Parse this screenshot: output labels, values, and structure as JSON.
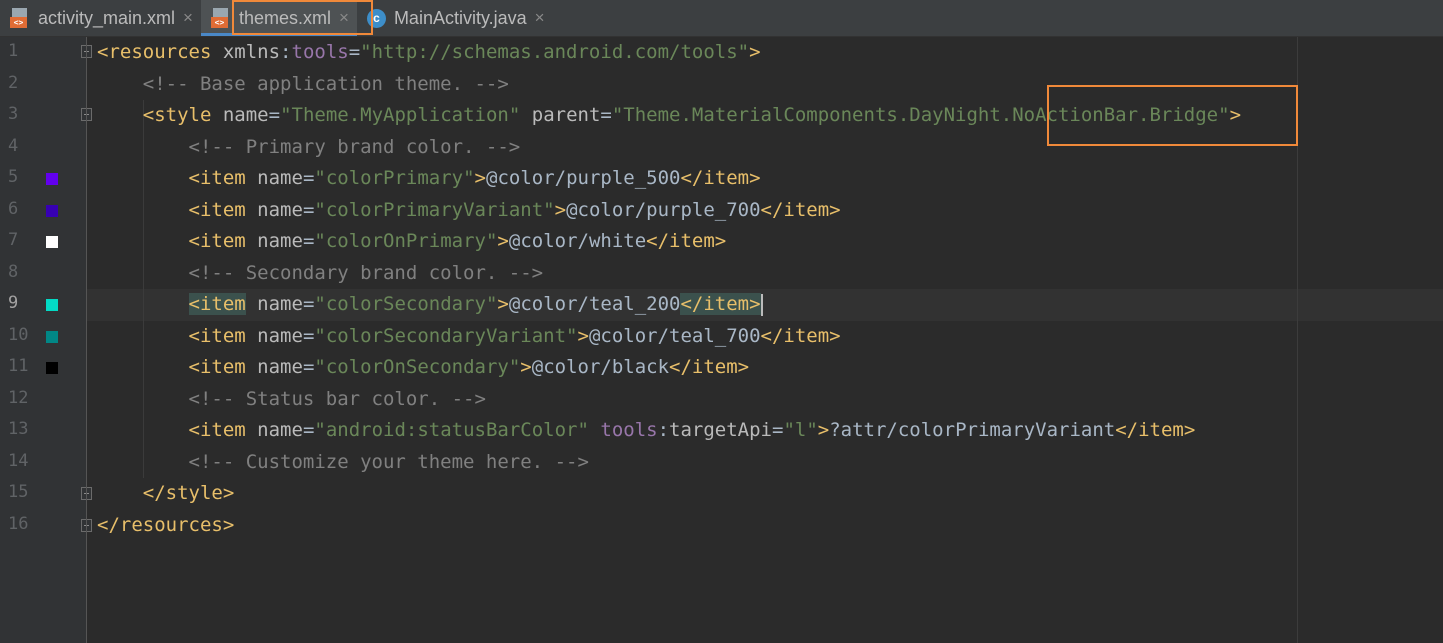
{
  "tabs": [
    {
      "label": "activity_main.xml",
      "icon": "xml-file-icon",
      "active": false
    },
    {
      "label": "themes.xml",
      "icon": "xml-file-icon",
      "active": true
    },
    {
      "label": "MainActivity.java",
      "icon": "java-class-icon",
      "active": false
    }
  ],
  "icons": {
    "xml_badge": "<>",
    "class_badge": "c",
    "close": "×"
  },
  "colors": {
    "purple_500": "#6200ee",
    "purple_700": "#3700b3",
    "white": "#ffffff",
    "teal_200": "#03dac5",
    "teal_700": "#018786",
    "black": "#000000",
    "highlight_border": "#f0893a"
  },
  "current_line": 9,
  "line_numbers": [
    "1",
    "2",
    "3",
    "4",
    "5",
    "6",
    "7",
    "8",
    "9",
    "10",
    "11",
    "12",
    "13",
    "14",
    "15",
    "16"
  ],
  "code": {
    "l1": {
      "open": "<resources",
      "attr": "xmlns",
      "colon": ":",
      "ns": "tools",
      "eq": "=",
      "val": "\"http://schemas.android.com/tools\"",
      "close": ">"
    },
    "l2": "<!-- Base application theme. -->",
    "l3": {
      "open": "<style",
      "attr1": "name",
      "eq1": "=",
      "val1": "\"Theme.MyApplication\"",
      "attr2": "parent",
      "eq2": "=",
      "val2a": "\"Theme.MaterialComponents.DayNight",
      "val2b": ".NoActionBar.Bridge\"",
      "close": ">"
    },
    "l4": "<!-- Primary brand color. -->",
    "l5": {
      "open": "<item",
      "attr": "name",
      "eq": "=",
      "val": "\"colorPrimary\"",
      "gt": ">",
      "text": "@color/purple_500",
      "close": "</item>"
    },
    "l6": {
      "open": "<item",
      "attr": "name",
      "eq": "=",
      "val": "\"colorPrimaryVariant\"",
      "gt": ">",
      "text": "@color/purple_700",
      "close": "</item>"
    },
    "l7": {
      "open": "<item",
      "attr": "name",
      "eq": "=",
      "val": "\"colorOnPrimary\"",
      "gt": ">",
      "text": "@color/white",
      "close": "</item>"
    },
    "l8": "<!-- Secondary brand color. -->",
    "l9": {
      "open": "<item",
      "attr": "name",
      "eq": "=",
      "val": "\"colorSecondary\"",
      "gt": ">",
      "text": "@color/teal_200",
      "close": "</item>"
    },
    "l10": {
      "open": "<item",
      "attr": "name",
      "eq": "=",
      "val": "\"colorSecondaryVariant\"",
      "gt": ">",
      "text": "@color/teal_700",
      "close": "</item>"
    },
    "l11": {
      "open": "<item",
      "attr": "name",
      "eq": "=",
      "val": "\"colorOnSecondary\"",
      "gt": ">",
      "text": "@color/black",
      "close": "</item>"
    },
    "l12": "<!-- Status bar color. -->",
    "l13": {
      "open": "<item",
      "attr": "name",
      "eq": "=",
      "val": "\"android:statusBarColor\"",
      "ns": "tools",
      "colon": ":",
      "attr2": "targetApi",
      "eq2": "=",
      "val2": "\"l\"",
      "gt": ">",
      "text": "?attr/colorPrimaryVariant",
      "close": "</item>"
    },
    "l14": "<!-- Customize your theme here. -->",
    "l15": "</style>",
    "l16": "</resources>"
  }
}
